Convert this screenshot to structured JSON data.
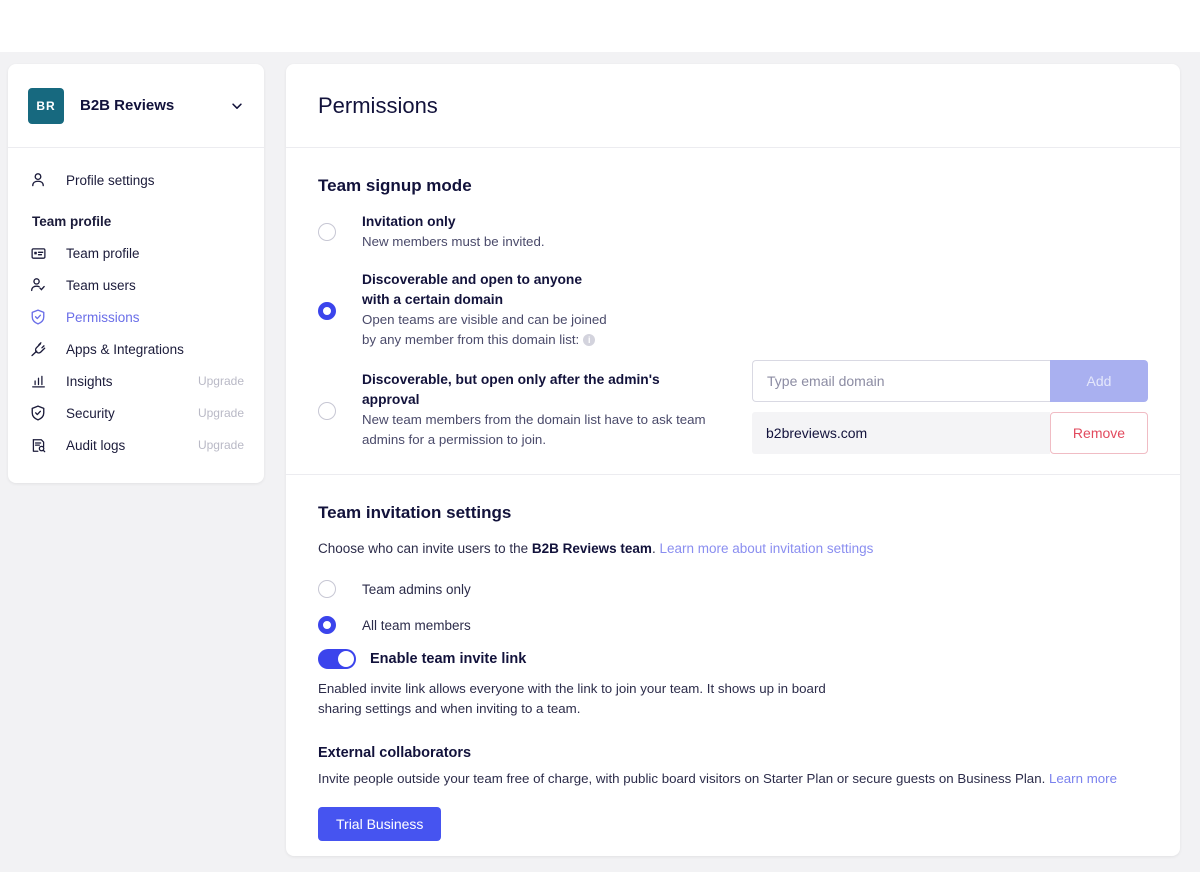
{
  "colors": {
    "accent": "#3b44ec",
    "accent_button": "#4654f0",
    "active_nav": "#6a6ee8",
    "logo_bg": "#17697f",
    "danger": "#e24a5e",
    "page_bg": "#f2f2f4"
  },
  "sidebar": {
    "team_logo_initials": "BR",
    "team_name": "B2B Reviews",
    "chevron_icon": "chevron-down-icon",
    "profile": {
      "label": "Profile settings",
      "icon": "person-icon"
    },
    "section_title": "Team profile",
    "items": [
      {
        "label": "Team profile",
        "icon": "id-card-icon",
        "active": false,
        "tag": ""
      },
      {
        "label": "Team users",
        "icon": "person-check-icon",
        "active": false,
        "tag": ""
      },
      {
        "label": "Permissions",
        "icon": "shield-check-icon",
        "active": true,
        "tag": ""
      },
      {
        "label": "Apps & Integrations",
        "icon": "plug-icon",
        "active": false,
        "tag": ""
      },
      {
        "label": "Insights",
        "icon": "bar-chart-icon",
        "active": false,
        "tag": "Upgrade"
      },
      {
        "label": "Security",
        "icon": "shield-icon",
        "active": false,
        "tag": "Upgrade"
      },
      {
        "label": "Audit logs",
        "icon": "document-search-icon",
        "active": false,
        "tag": "Upgrade"
      }
    ]
  },
  "main": {
    "page_title": "Permissions",
    "signup": {
      "title": "Team signup mode",
      "options": [
        {
          "title": "Invitation only",
          "desc": "New members must be invited.",
          "selected": false
        },
        {
          "title_line1": "Discoverable and open to anyone",
          "title_line2": "with a certain domain",
          "desc_line1": "Open teams are visible and can be joined",
          "desc_line2": "by any member from this domain list:",
          "info_icon": "info-icon",
          "selected": true
        },
        {
          "title_line1": "Discoverable, but open only after the admin's",
          "title_line2": "approval",
          "desc_line1": "New team members from the domain list have to ask team",
          "desc_line2": "admins for a permission to join.",
          "selected": false
        }
      ],
      "domain_input_placeholder": "Type email domain",
      "domain_input_value": "",
      "add_label": "Add",
      "domains": [
        {
          "name": "b2breviews.com",
          "remove_label": "Remove"
        }
      ]
    },
    "invitation": {
      "title": "Team invitation settings",
      "desc_prefix": "Choose who can invite users to the ",
      "desc_team": "B2B Reviews team",
      "desc_suffix": ".",
      "desc_link": "Learn more about invitation settings",
      "options": [
        {
          "label": "Team admins only",
          "selected": false
        },
        {
          "label": "All team members",
          "selected": true
        }
      ],
      "toggle_label": "Enable team invite link",
      "toggle_on": true,
      "toggle_desc_line1": "Enabled invite link allows everyone with the link to join your team. It shows up in board",
      "toggle_desc_line2": "sharing settings and when inviting to a team.",
      "external_title": "External collaborators",
      "external_desc": "Invite people outside your team free of charge, with public board visitors on Starter Plan or secure guests on Business Plan.",
      "external_link": "Learn more",
      "trial_button": "Trial Business"
    }
  }
}
